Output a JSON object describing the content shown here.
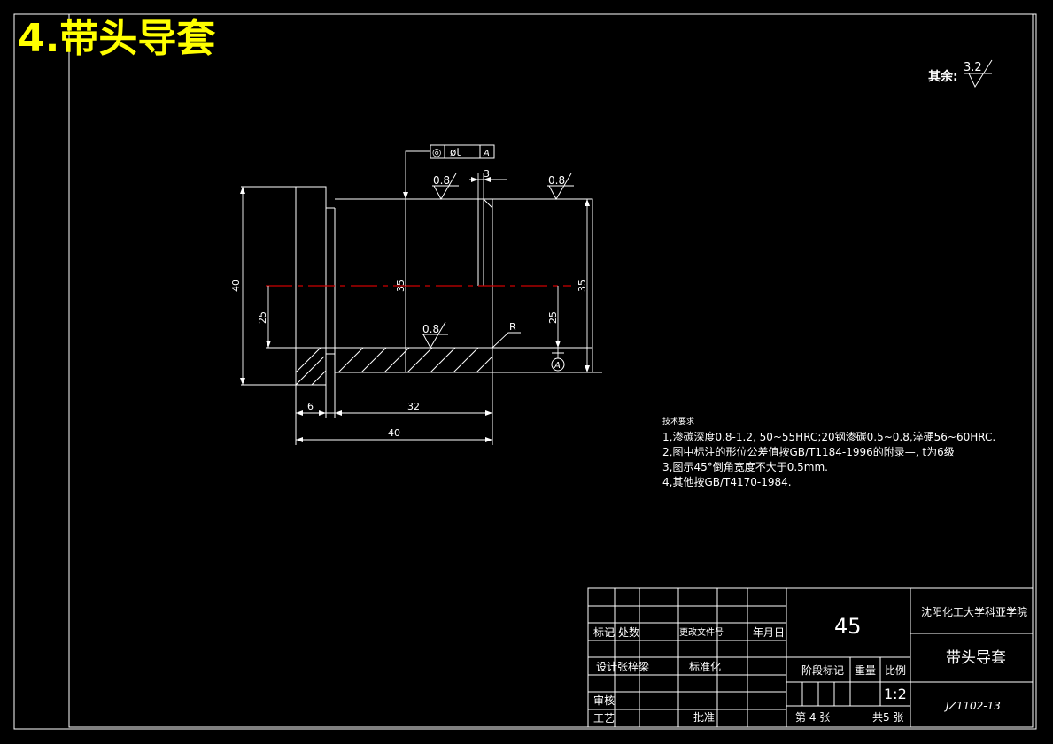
{
  "header": {
    "title": "4.带头导套"
  },
  "roughness_note": {
    "label": "其余:",
    "value": "3.2"
  },
  "drawing": {
    "tolerance_frame": {
      "symbol": "◎",
      "value": "øt",
      "datum": "A"
    },
    "roughness": [
      "0.8",
      "0.8",
      "0.8"
    ],
    "dimensions": {
      "groove_width": "3",
      "height_total": "40",
      "height_bore_left": "35",
      "height_bore_right": "35",
      "height_lower_left": "25",
      "height_lower_right": "25",
      "width_flange": "6",
      "width_body": "32",
      "width_total": "40",
      "radius": "R"
    },
    "datum_label": "A"
  },
  "tech_requirements": {
    "heading": "技术要求",
    "items": [
      "1,渗碳深度0.8-1.2, 50~55HRC;20钢渗碳0.5~0.8,淬硬56~60HRC.",
      "2,图中标注的形位公差值按GB/T1184-1996的附录—, t为6级",
      "3,图示45°倒角宽度不大于0.5mm.",
      "4,其他按GB/T4170-1984."
    ]
  },
  "title_block": {
    "row_mark": [
      "标记",
      "处数",
      "更改文件号",
      "年月日"
    ],
    "row_design": [
      "设计",
      "张梓梁",
      "标准化"
    ],
    "row_review": "审核",
    "row_process": [
      "工艺",
      "批准"
    ],
    "material": "45",
    "school": "沈阳化工大学科亚学院",
    "part_name": "带头导套",
    "stage_label": "阶段标记",
    "weight_label": "重量",
    "scale_label": "比例",
    "scale_value": "1:2",
    "drawing_number": "JZ1102-13",
    "sheet_no": "第 4 张",
    "sheet_total": "共5 张"
  }
}
